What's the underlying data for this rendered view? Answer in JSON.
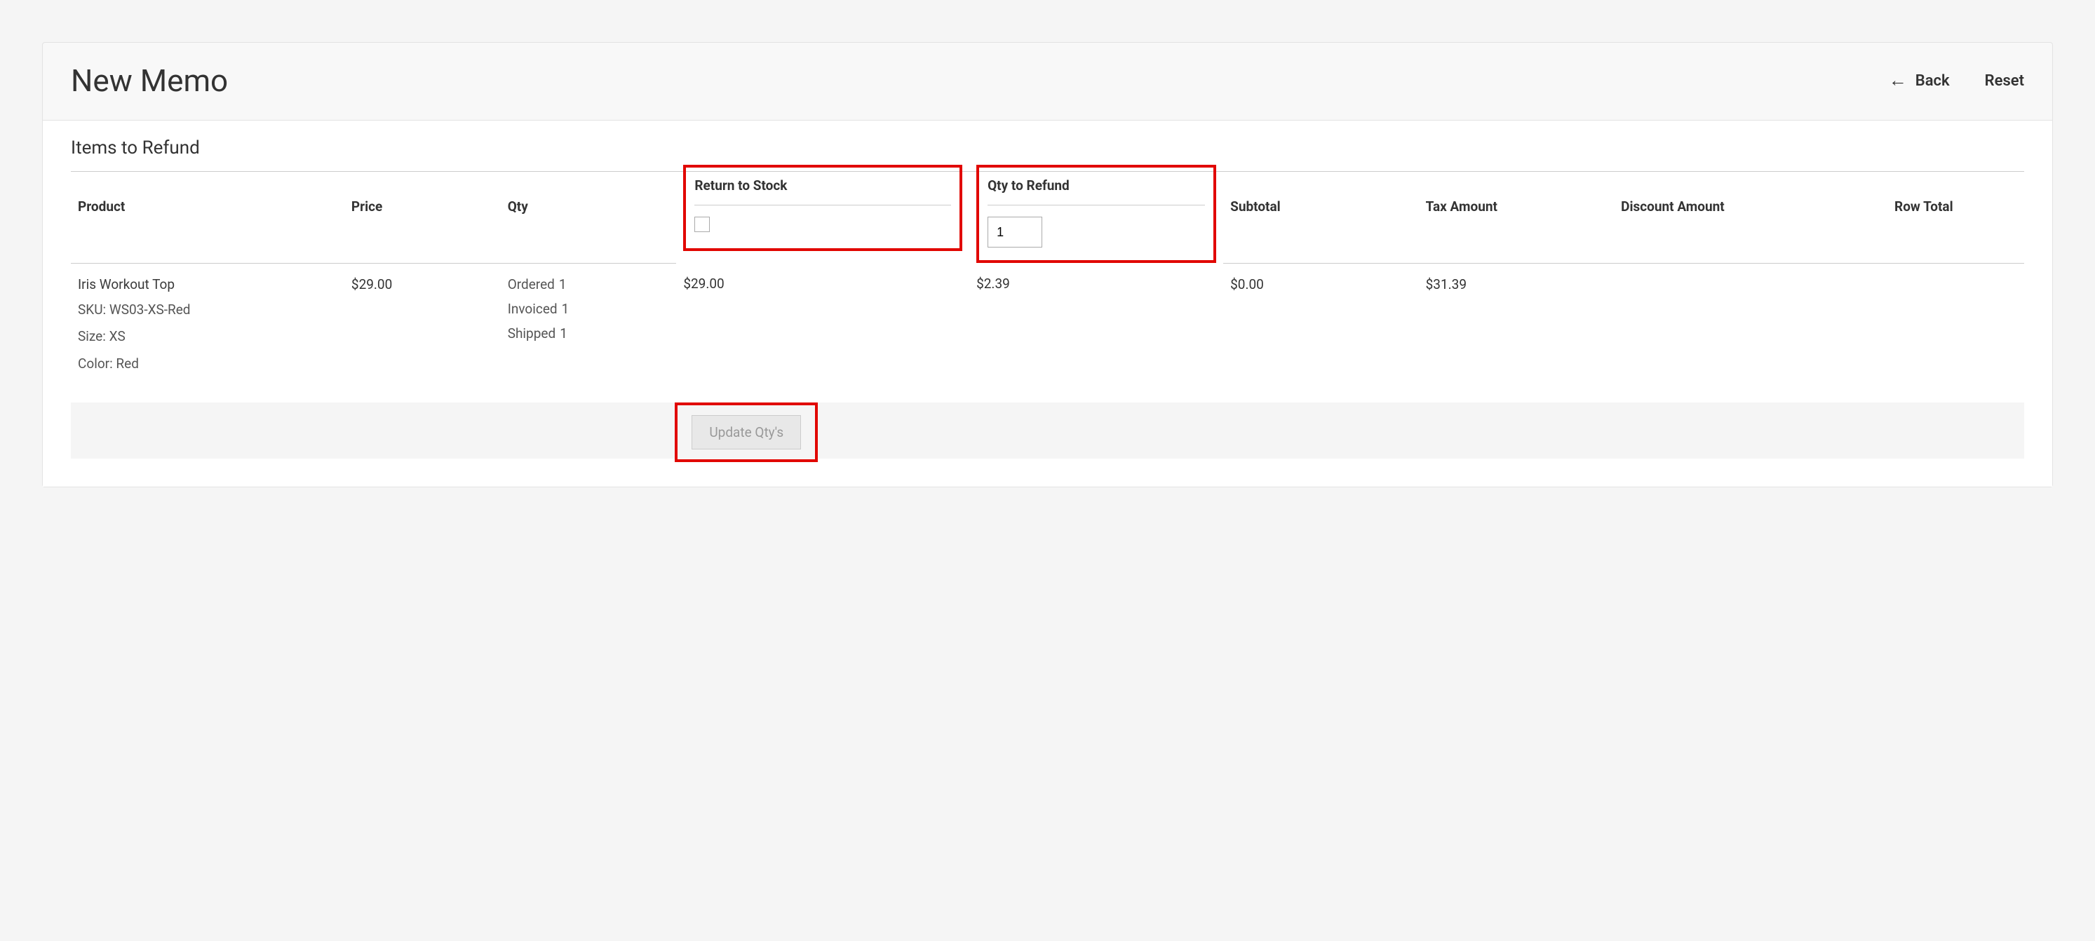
{
  "header": {
    "page_title": "New Memo",
    "back_label": "Back",
    "reset_label": "Reset"
  },
  "section": {
    "title": "Items to Refund"
  },
  "columns": {
    "product": "Product",
    "price": "Price",
    "qty": "Qty",
    "return_to_stock": "Return to Stock",
    "qty_to_refund": "Qty to Refund",
    "subtotal": "Subtotal",
    "tax_amount": "Tax Amount",
    "discount_amount": "Discount Amount",
    "row_total": "Row Total"
  },
  "item": {
    "name": "Iris Workout Top",
    "sku_label": "SKU: WS03-XS-Red",
    "size_label": "Size: XS",
    "color_label": "Color: Red",
    "price": "$29.00",
    "qty": {
      "ordered_label": "Ordered",
      "ordered_value": "1",
      "invoiced_label": "Invoiced",
      "invoiced_value": "1",
      "shipped_label": "Shipped",
      "shipped_value": "1"
    },
    "return_to_stock_checked": false,
    "qty_to_refund": "1",
    "subtotal": "$29.00",
    "tax_amount": "$2.39",
    "discount_amount": "$0.00",
    "row_total": "$31.39"
  },
  "actions": {
    "update_qtys": "Update Qty's"
  }
}
